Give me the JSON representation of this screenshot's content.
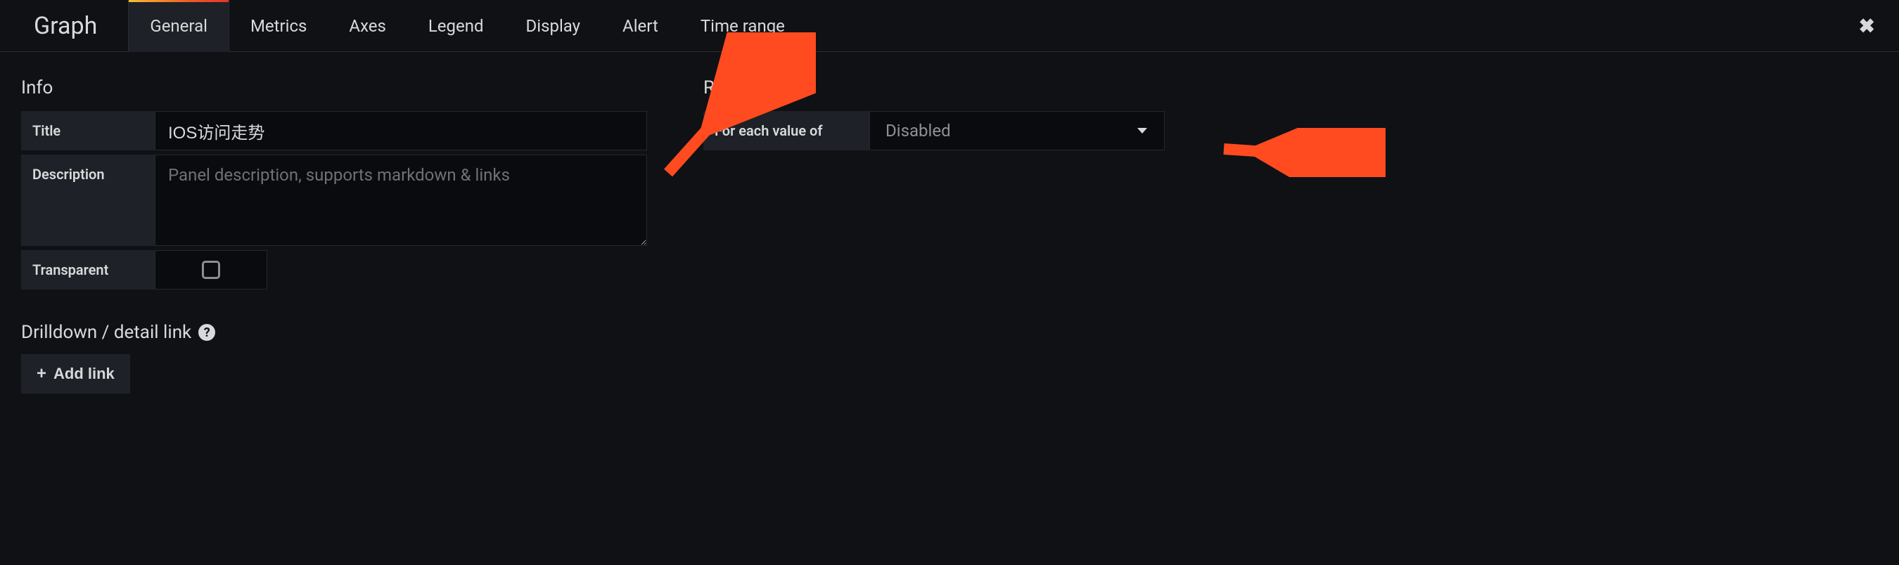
{
  "header": {
    "panel_type": "Graph",
    "tabs": [
      "General",
      "Metrics",
      "Axes",
      "Legend",
      "Display",
      "Alert",
      "Time range"
    ],
    "active_tab_index": 0
  },
  "info": {
    "heading": "Info",
    "title_label": "Title",
    "title_value": "IOS访问走势",
    "description_label": "Description",
    "description_value": "",
    "description_placeholder": "Panel description, supports markdown & links",
    "transparent_label": "Transparent",
    "transparent_checked": false
  },
  "repeat": {
    "heading": "Repeat",
    "for_each_label": "For each value of",
    "select_value": "Disabled"
  },
  "drilldown": {
    "heading": "Drilldown / detail link",
    "add_link_label": "Add link"
  },
  "colors": {
    "accent_gradient_from": "#f7bf2f",
    "accent_gradient_to": "#e6352b",
    "annotation": "#ff4b1f"
  }
}
